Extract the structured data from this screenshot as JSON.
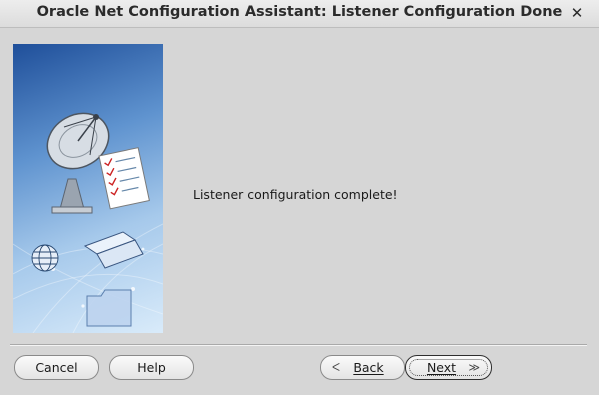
{
  "window": {
    "title": "Oracle Net Configuration Assistant: Listener Configuration Done",
    "close_glyph": "✕"
  },
  "content": {
    "message": "Listener configuration complete!",
    "illustration": "oracle-network-wizard-illustration"
  },
  "buttons": {
    "cancel": "Cancel",
    "help": "Help",
    "back": "Back",
    "back_glyph": "ᐸ",
    "next": "Next",
    "next_glyph": "≫"
  },
  "colors": {
    "window_bg": "#d6d6d6",
    "panel_dark": "#1f4f9a",
    "panel_light": "#d9ebfa"
  }
}
